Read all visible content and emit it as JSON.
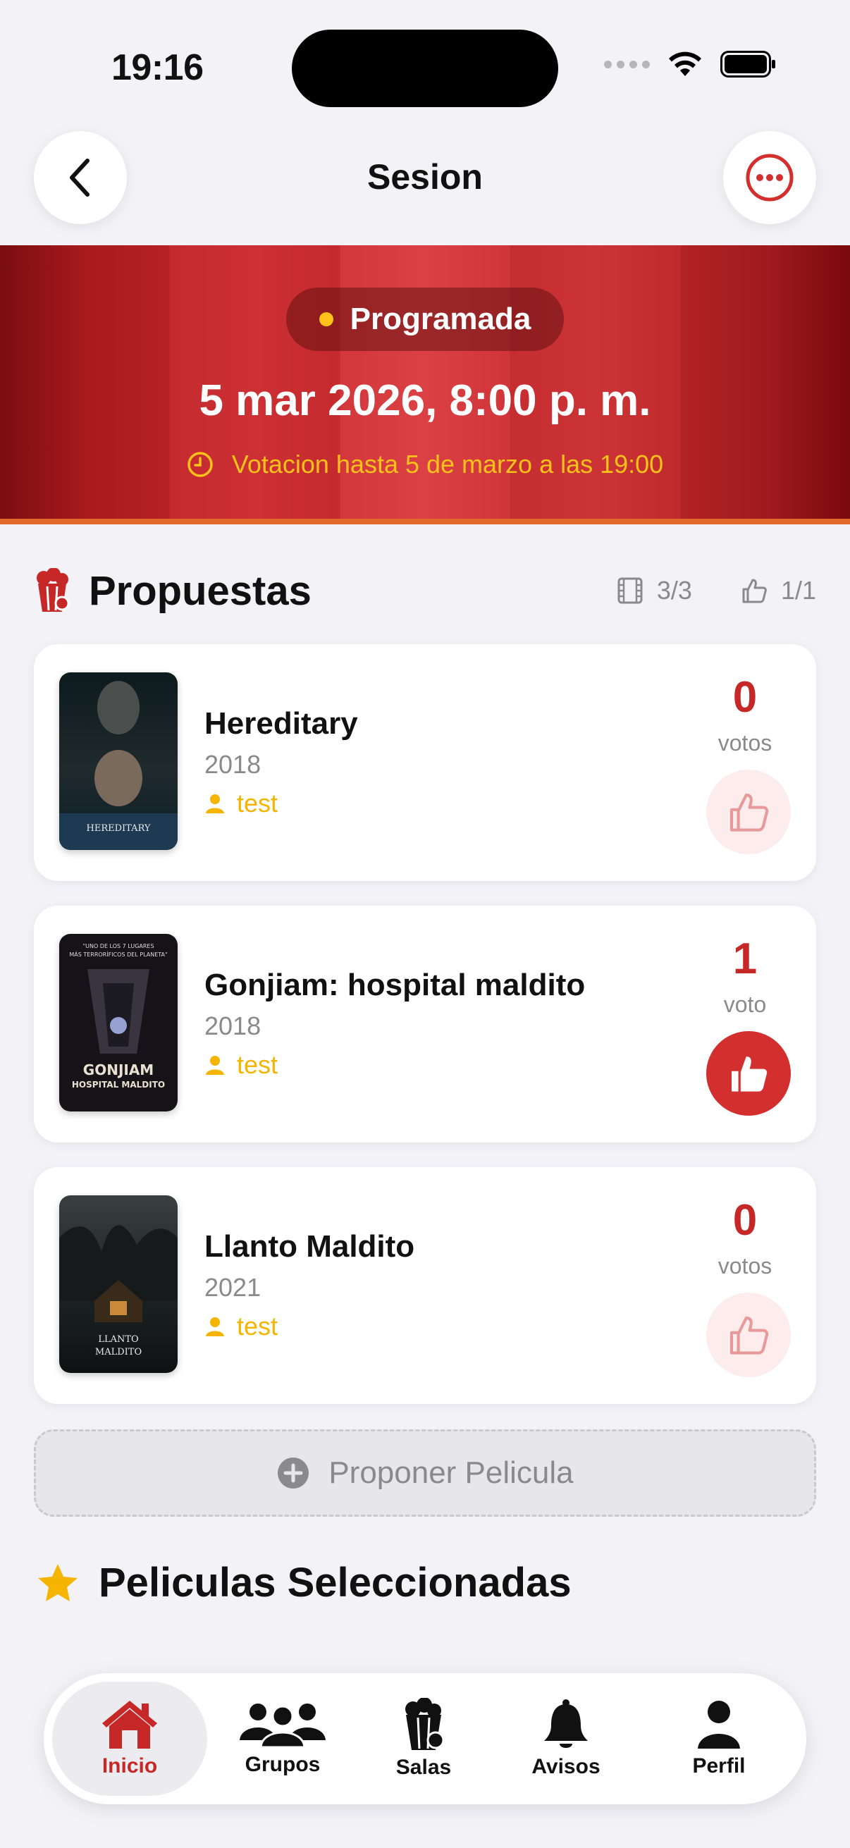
{
  "status_bar": {
    "time": "19:16"
  },
  "nav": {
    "title": "Sesion"
  },
  "banner": {
    "status": "Programada",
    "date": "5 mar 2026, 8:00 p. m.",
    "vote_deadline": "Votacion hasta 5 de marzo a las 19:00"
  },
  "proposals": {
    "title": "Propuestas",
    "films_count": "3/3",
    "likes_count": "1/1",
    "items": [
      {
        "title": "Hereditary",
        "year": "2018",
        "user": "test",
        "votes": "0",
        "votes_label": "votos",
        "voted": false,
        "poster_text": "HEREDITARY"
      },
      {
        "title": "Gonjiam: hospital maldito",
        "year": "2018",
        "user": "test",
        "votes": "1",
        "votes_label": "voto",
        "voted": true,
        "poster_text": "GONJIAM HOSPITAL MALDITO"
      },
      {
        "title": "Llanto Maldito",
        "year": "2021",
        "user": "test",
        "votes": "0",
        "votes_label": "votos",
        "voted": false,
        "poster_text": "LLANTO MALDITO"
      }
    ],
    "propose_label": "Proponer Pelicula"
  },
  "selected": {
    "title": "Peliculas Seleccionadas"
  },
  "tabbar": {
    "items": [
      {
        "label": "Inicio",
        "icon": "house-icon",
        "active": true
      },
      {
        "label": "Grupos",
        "icon": "people-icon",
        "active": false
      },
      {
        "label": "Salas",
        "icon": "popcorn-icon",
        "active": false
      },
      {
        "label": "Avisos",
        "icon": "bell-icon",
        "active": false
      },
      {
        "label": "Perfil",
        "icon": "person-icon",
        "active": false
      }
    ]
  },
  "colors": {
    "accent": "#c62828",
    "gold": "#ffc21a",
    "user": "#f5b400",
    "muted": "#8a8a8e"
  }
}
